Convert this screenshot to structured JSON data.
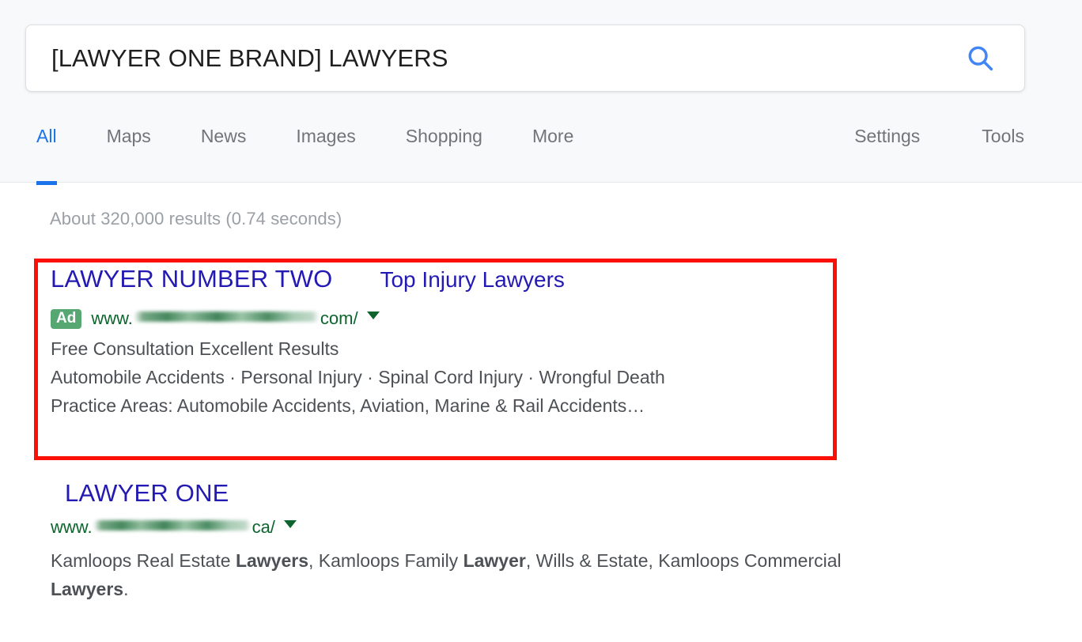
{
  "search": {
    "query": "[LAWYER ONE BRAND] LAWYERS",
    "placeholder": "Search",
    "search_icon": "search-icon"
  },
  "nav": {
    "tabs": [
      {
        "label": "All",
        "active": true
      },
      {
        "label": "Maps",
        "active": false
      },
      {
        "label": "News",
        "active": false
      },
      {
        "label": "Images",
        "active": false
      },
      {
        "label": "Shopping",
        "active": false
      },
      {
        "label": "More",
        "active": false
      }
    ],
    "right_items": [
      {
        "label": "Settings"
      },
      {
        "label": "Tools"
      }
    ]
  },
  "results_page": {
    "stats": "About 320,000 results (0.74 seconds)",
    "annotation": {
      "color": "#fc0f07",
      "name": "red-highlight-box"
    }
  },
  "ad_result": {
    "title": "LAWYER NUMBER TWO",
    "title_secondary": "Top Injury Lawyers",
    "badge": "Ad",
    "badge_color": "#57a773",
    "url_prefix": "www.",
    "url_suffix": "com/",
    "url_color": "#0d652d",
    "caret_icon": "chevron-down-icon",
    "description_lines": [
      "Free Consultation Excellent Results",
      "Automobile Accidents · Personal Injury · Spinal Cord Injury · Wrongful Death",
      "Practice Areas: Automobile Accidents, Aviation, Marine & Rail Accidents…"
    ]
  },
  "organic_result": {
    "title": "LAWYER ONE",
    "url_prefix": "www.",
    "url_suffix": "ca/",
    "url_color": "#0d652d",
    "caret_icon": "chevron-down-icon",
    "snippet_parts": [
      {
        "text": "Kamloops Real Estate ",
        "bold": false
      },
      {
        "text": "Lawyers",
        "bold": true
      },
      {
        "text": ", Kamloops Family ",
        "bold": false
      },
      {
        "text": "Lawyer",
        "bold": true
      },
      {
        "text": ", Wills & Estate, Kamloops Commercial ",
        "bold": false
      },
      {
        "text": "Lawyers",
        "bold": true
      },
      {
        "text": ".",
        "bold": false
      }
    ]
  },
  "theme": {
    "link_color": "#2319b3",
    "accent_blue": "#1a73e8",
    "header_bg": "#f8f9fa"
  }
}
